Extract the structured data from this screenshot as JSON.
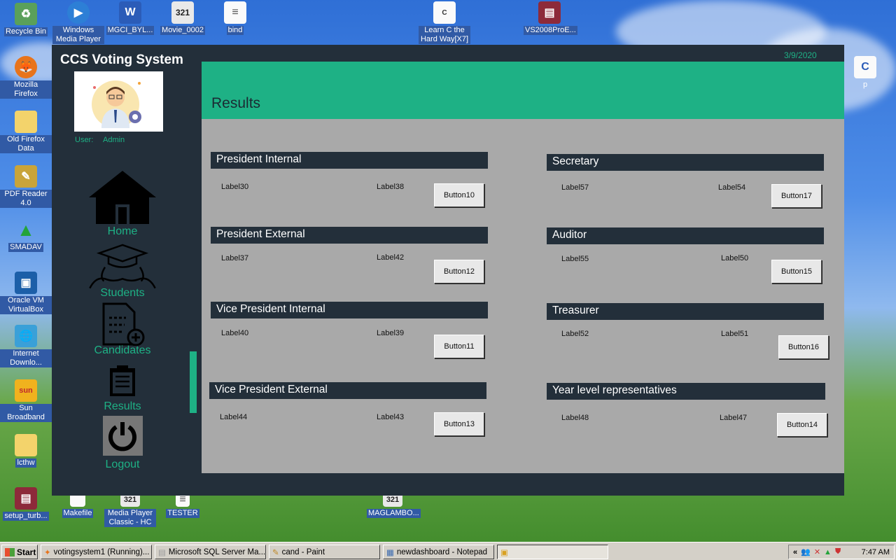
{
  "desktop": {
    "icons_left": [
      {
        "label": "Recycle Bin",
        "icon": "recycle-bin-icon"
      },
      {
        "label": "Mozilla Firefox",
        "icon": "firefox-icon"
      },
      {
        "label": "Old Firefox Data",
        "icon": "folder-icon"
      },
      {
        "label": "PDF Reader 4.0",
        "icon": "pdf-icon"
      },
      {
        "label": "SMADAV",
        "icon": "smadav-icon"
      },
      {
        "label": "Oracle VM VirtualBox",
        "icon": "virtualbox-icon"
      },
      {
        "label": "Internet Downlo...",
        "icon": "download-icon"
      },
      {
        "label": "Sun Broadband",
        "icon": "sun-icon"
      },
      {
        "label": "lcthw",
        "icon": "folder-icon"
      },
      {
        "label": "setup_turb...",
        "icon": "archive-icon"
      }
    ],
    "icons_top": [
      {
        "label": "Windows Media Player",
        "icon": "media-player-icon"
      },
      {
        "label": "MGCI_BYL...",
        "icon": "word-doc-icon"
      },
      {
        "label": "Movie_0002",
        "icon": "video-icon"
      },
      {
        "label": "bind",
        "icon": "text-file-icon"
      },
      {
        "label": "Learn C the Hard Way[X7]",
        "icon": "document-icon"
      },
      {
        "label": "VS2008ProE...",
        "icon": "archive-icon"
      }
    ],
    "icons_bottom": [
      {
        "label": "Makefile",
        "icon": "document-icon"
      },
      {
        "label": "Media Player Classic - HC",
        "icon": "video-icon"
      },
      {
        "label": "TESTER",
        "icon": "text-file-icon"
      },
      {
        "label": "MAGLAMBO...",
        "icon": "video-icon"
      }
    ],
    "icon_right": {
      "label": "p",
      "icon": "c-source-file-icon"
    }
  },
  "app": {
    "title": "CCS Voting System",
    "date": "3/9/2020",
    "user_label": "User:",
    "user_value": "Admin",
    "page_title": "Results",
    "nav": [
      {
        "label": "Home",
        "icon": "home-icon"
      },
      {
        "label": "Students",
        "icon": "students-icon"
      },
      {
        "label": "Candidates",
        "icon": "candidates-icon"
      },
      {
        "label": "Results",
        "icon": "results-clipboard-icon"
      },
      {
        "label": "Logout",
        "icon": "power-icon"
      }
    ],
    "sections": [
      {
        "title": "President Internal",
        "label_a": "Label30",
        "label_b": "Label38",
        "button": "Button10"
      },
      {
        "title": "President External",
        "label_a": "Label37",
        "label_b": "Label42",
        "button": "Button12"
      },
      {
        "title": "Vice President Internal",
        "label_a": "Label40",
        "label_b": "Label39",
        "button": "Button11"
      },
      {
        "title": "Vice President External",
        "label_a": "Label44",
        "label_b": "Label43",
        "button": "Button13"
      },
      {
        "title": "Secretary",
        "label_a": "Label57",
        "label_b": "Label54",
        "button": "Button17"
      },
      {
        "title": "Auditor",
        "label_a": "Label55",
        "label_b": "Label50",
        "button": "Button15"
      },
      {
        "title": "Treasurer",
        "label_a": "Label52",
        "label_b": "Label51",
        "button": "Button16"
      },
      {
        "title": "Year level representatives",
        "label_a": "Label48",
        "label_b": "Label47",
        "button": "Button14"
      }
    ]
  },
  "taskbar": {
    "start": "Start",
    "tasks": [
      {
        "label": "votingsystem1 (Running)...",
        "icon": "virtualbox-icon"
      },
      {
        "label": "Microsoft SQL Server Ma...",
        "icon": "sql-server-icon"
      },
      {
        "label": "cand - Paint",
        "icon": "paint-icon"
      },
      {
        "label": "newdashboard - Notepad",
        "icon": "notepad-icon"
      },
      {
        "label": "",
        "icon": "app-window-icon"
      }
    ],
    "time": "7:47 AM",
    "tray_chevron": "«"
  },
  "colors": {
    "accent": "#1eb185",
    "panel": "#232f3a",
    "content_bg": "#a9a9a9"
  }
}
